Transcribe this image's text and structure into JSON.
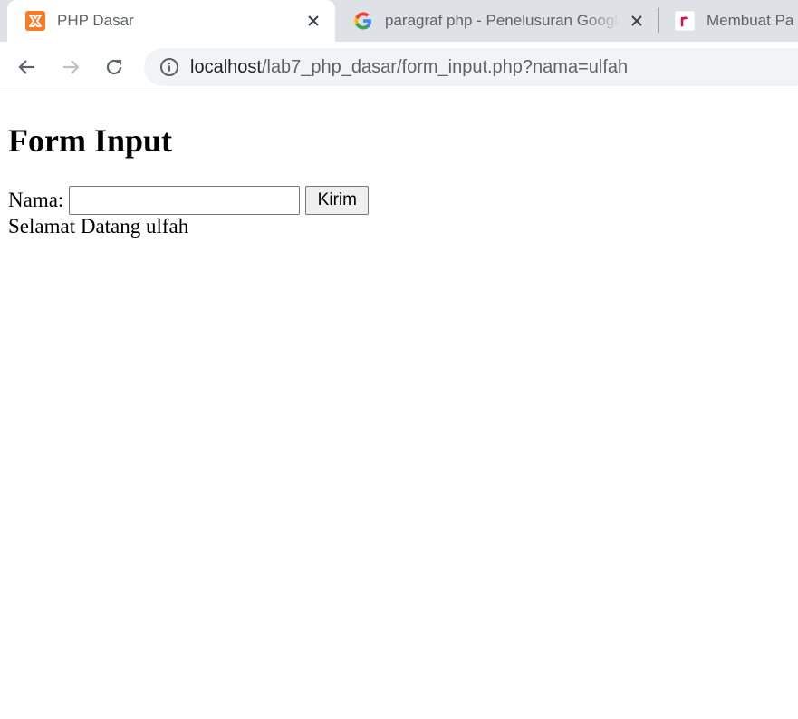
{
  "browser": {
    "tabs": [
      {
        "title": "PHP Dasar",
        "icon": "xampp-icon",
        "active": true
      },
      {
        "title": "paragraf php - Penelusuran Google",
        "icon": "google-icon",
        "active": false
      },
      {
        "title": "Membuat Pa",
        "icon": "site-favicon-icon",
        "active": false
      }
    ],
    "address": {
      "host": "localhost",
      "path": "/lab7_php_dasar/form_input.php?nama=ulfah"
    },
    "colors": {
      "tabstrip": "#dee1e6",
      "omnibox": "#f1f3f4",
      "xampp_orange": "#fb7a24"
    }
  },
  "page": {
    "title": "Form Input",
    "form": {
      "label": "Nama:",
      "input_value": "",
      "submit_label": "Kirim"
    },
    "greeting": "Selamat Datang ulfah"
  }
}
